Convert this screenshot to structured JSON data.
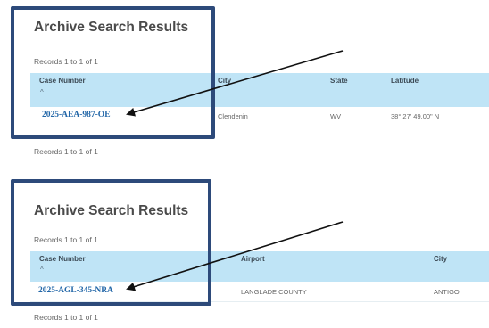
{
  "panels": [
    {
      "title": "Archive Search Results",
      "records_top": "Records 1 to 1 of 1",
      "columns": [
        "Case Number",
        "City",
        "State",
        "Latitude"
      ],
      "sort_indicator": "^",
      "row": {
        "case_number": "2025-AEA-987-OE",
        "cells": [
          "Clendenin",
          "WV",
          "38° 27' 49.00\" N"
        ]
      },
      "records_bottom": "Records 1 to 1 of 1"
    },
    {
      "title": "Archive Search Results",
      "records_top": "Records 1 to 1 of 1",
      "columns": [
        "Case Number",
        "Airport",
        "City"
      ],
      "sort_indicator": "^",
      "row": {
        "case_number": "2025-AGL-345-NRA",
        "cells": [
          "LANGLADE COUNTY",
          "ANTIGO"
        ]
      },
      "records_bottom": "Records 1 to 1 of 1"
    }
  ],
  "colors": {
    "highlight_border": "#2d4a7a",
    "header_background": "#bfe4f6",
    "link": "#2367a8",
    "arrow": "#111111"
  }
}
